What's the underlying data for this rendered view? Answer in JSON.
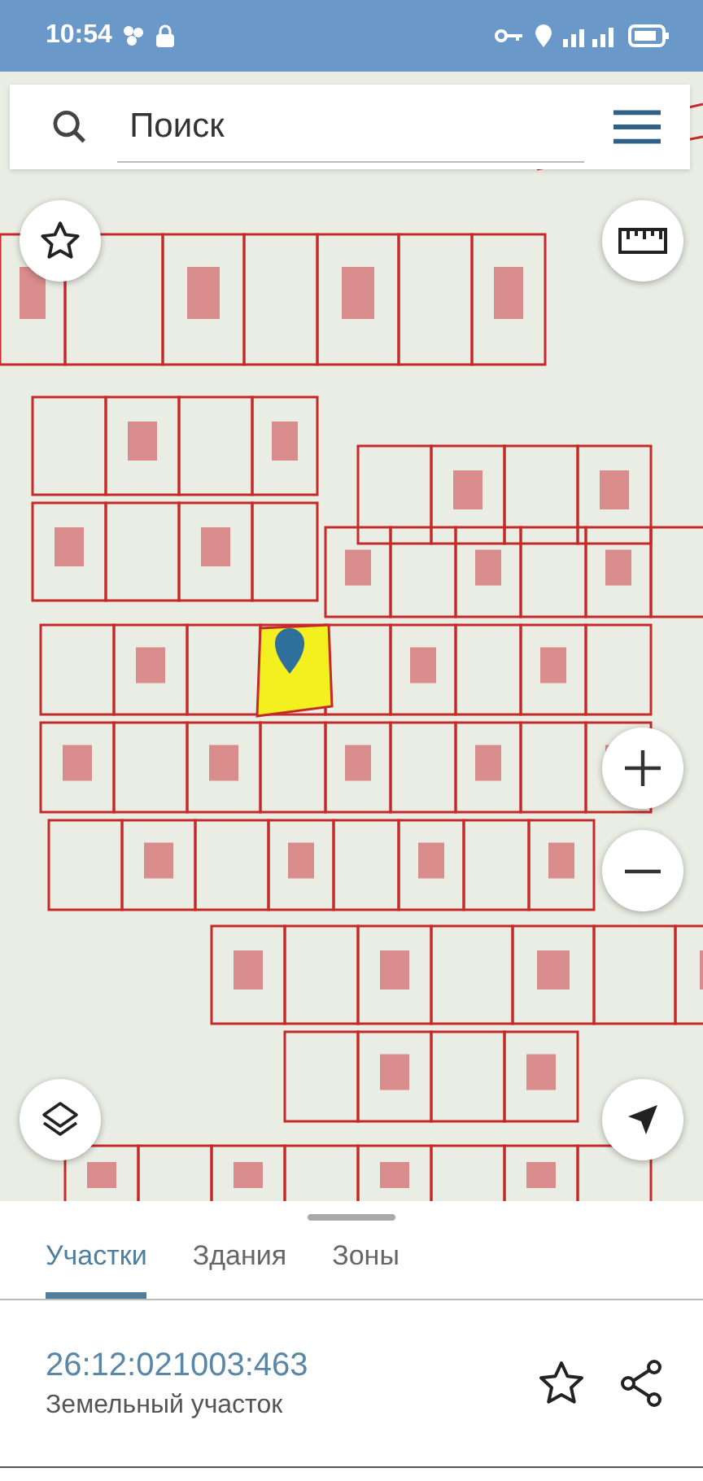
{
  "status_bar": {
    "time": "10:54"
  },
  "search": {
    "placeholder": "Поиск"
  },
  "tabs": [
    {
      "label": "Участки",
      "selected": true
    },
    {
      "label": "Здания",
      "selected": false
    },
    {
      "label": "Зоны",
      "selected": false
    }
  ],
  "parcel": {
    "number": "26:12:021003:463",
    "type": "Земельный участок"
  }
}
